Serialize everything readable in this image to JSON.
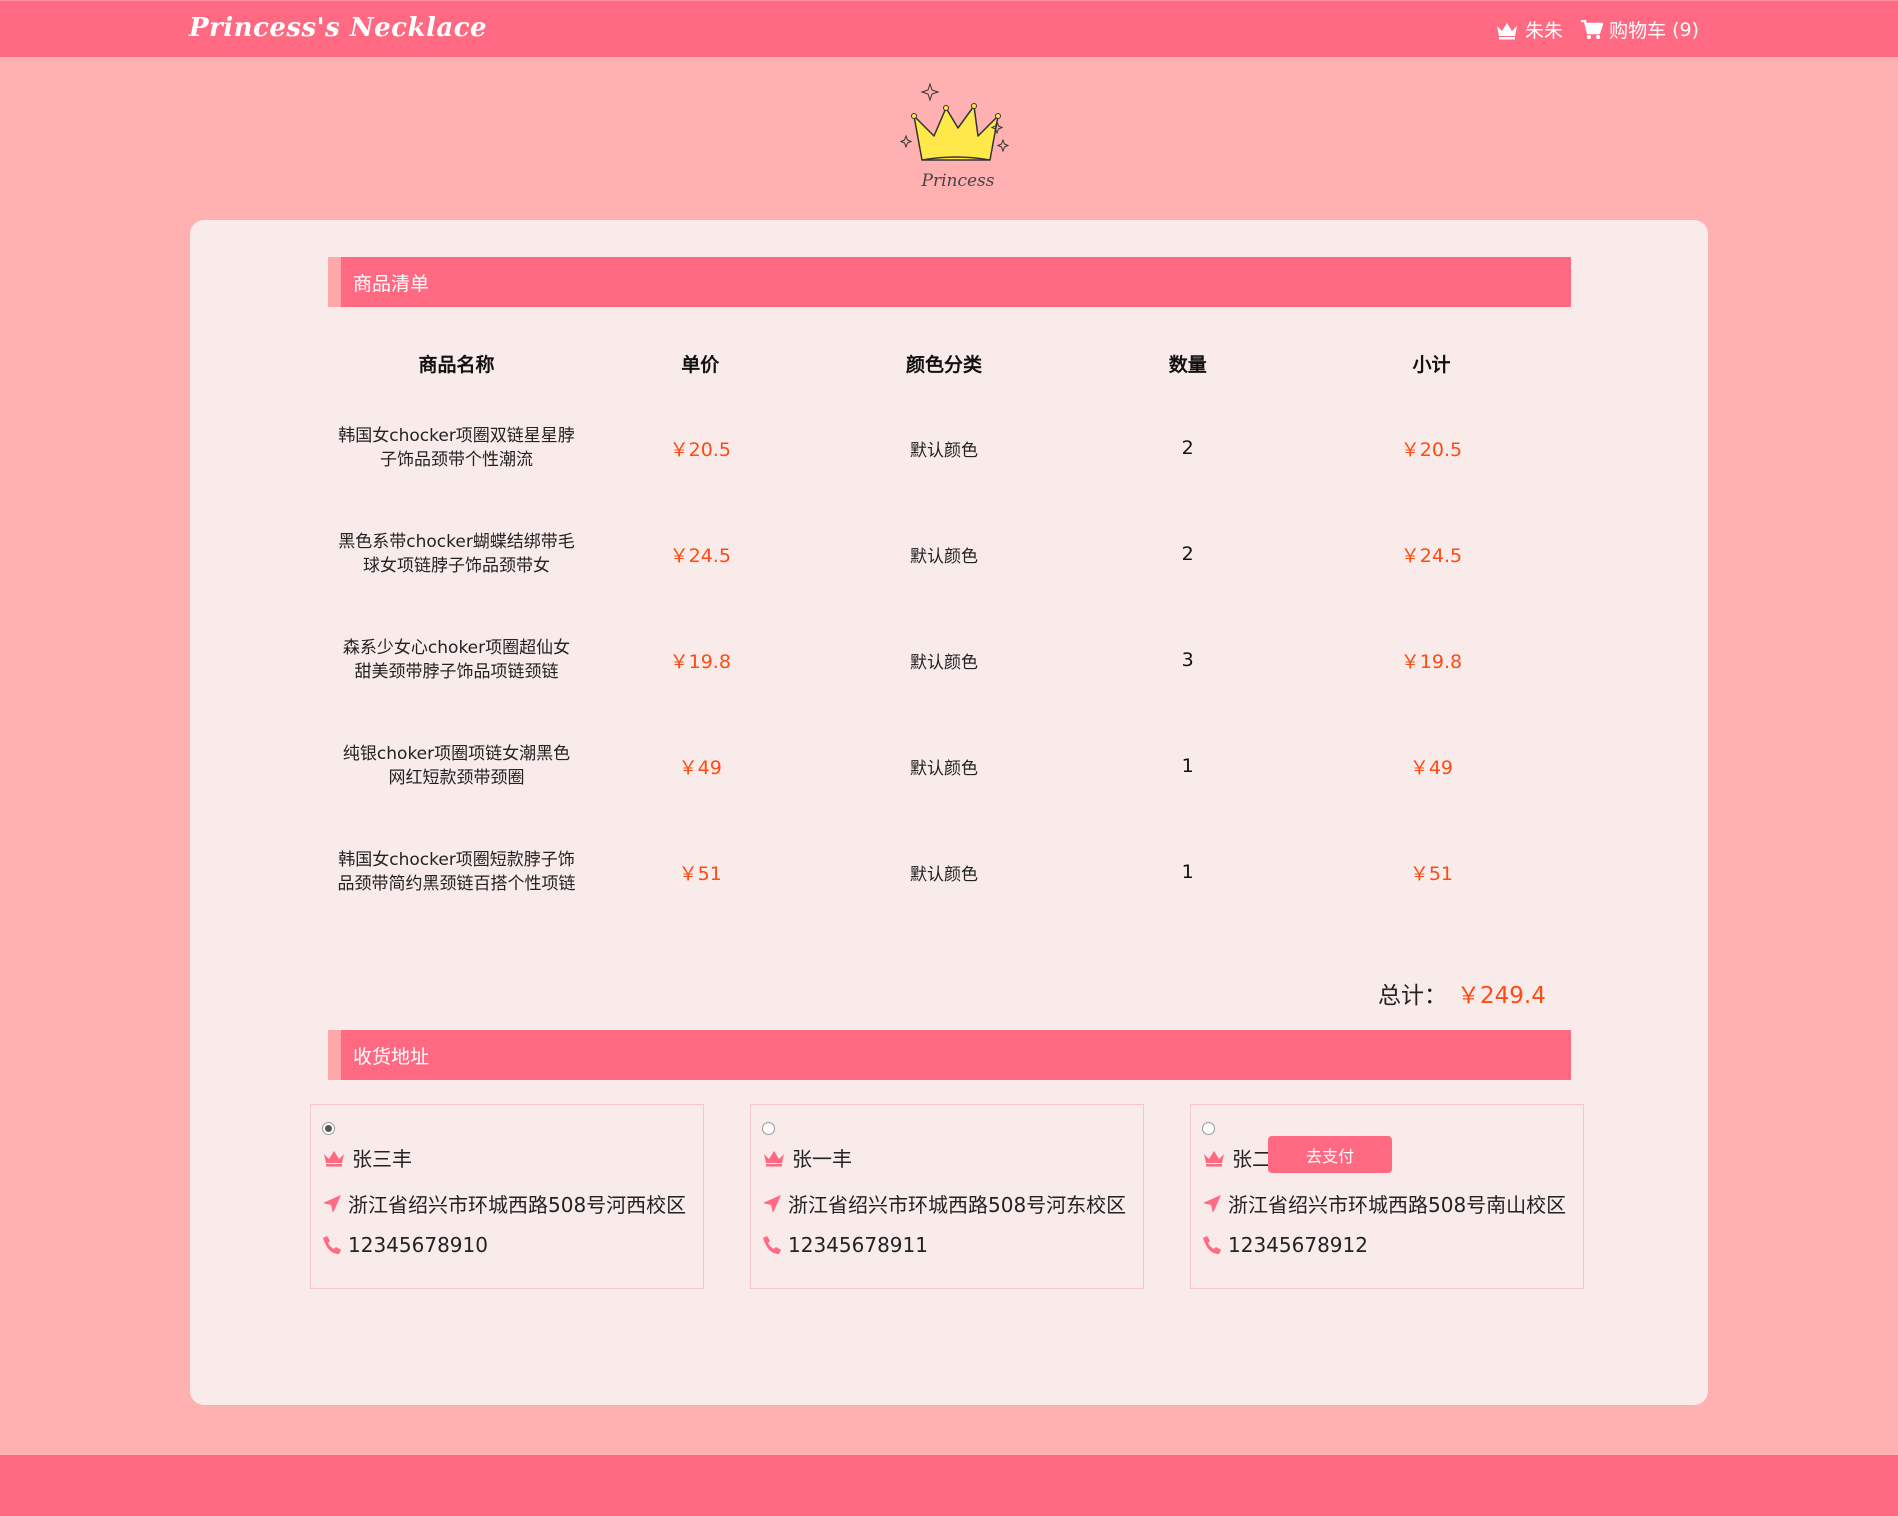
{
  "header": {
    "brand": "Princess's Necklace",
    "user_name": "朱朱",
    "cart_label": "购物车",
    "cart_count": "(9)"
  },
  "logo": {
    "text": "Princess"
  },
  "goods_section": {
    "title": "商品清单"
  },
  "table": {
    "headers": [
      "商品名称",
      "单价",
      "颜色分类",
      "数量",
      "小计"
    ],
    "rows": [
      {
        "name_line1": "韩国女chocker项圈双链星星脖",
        "name_line2": "子饰品颈带个性潮流",
        "price": "￥20.5",
        "color": "默认颜色",
        "qty": "2",
        "subtotal": "￥20.5"
      },
      {
        "name_line1": "黑色系带chocker蝴蝶结绑带毛",
        "name_line2": "球女项链脖子饰品颈带女",
        "price": "￥24.5",
        "color": "默认颜色",
        "qty": "2",
        "subtotal": "￥24.5"
      },
      {
        "name_line1": "森系少女心choker项圈超仙女",
        "name_line2": "甜美颈带脖子饰品项链颈链",
        "price": "￥19.8",
        "color": "默认颜色",
        "qty": "3",
        "subtotal": "￥19.8"
      },
      {
        "name_line1": "纯银choker项圈项链女潮黑色",
        "name_line2": "网红短款颈带颈圈",
        "price": "￥49",
        "color": "默认颜色",
        "qty": "1",
        "subtotal": "￥49"
      },
      {
        "name_line1": "韩国女chocker项圈短款脖子饰",
        "name_line2": "品颈带简约黑颈链百搭个性项链",
        "price": "￥51",
        "color": "默认颜色",
        "qty": "1",
        "subtotal": "￥51"
      }
    ]
  },
  "total": {
    "label": "总计：",
    "amount": "￥249.4"
  },
  "address_section": {
    "title": "收货地址"
  },
  "addresses": [
    {
      "name": "张三丰",
      "address": "浙江省绍兴市环城西路508号河西校区",
      "phone": "12345678910",
      "selected": true
    },
    {
      "name": "张一丰",
      "address": "浙江省绍兴市环城西路508号河东校区",
      "phone": "12345678911",
      "selected": false
    },
    {
      "name": "张二丰",
      "address": "浙江省绍兴市环城西路508号南山校区",
      "phone": "12345678912",
      "selected": false
    }
  ],
  "actions": {
    "pay_label": "去支付"
  },
  "colors": {
    "primary": "#ff6982",
    "background": "#ffb1b1",
    "card": "#f9ebea",
    "price": "#ff4a12",
    "crown_yellow": "#ffe84a"
  }
}
